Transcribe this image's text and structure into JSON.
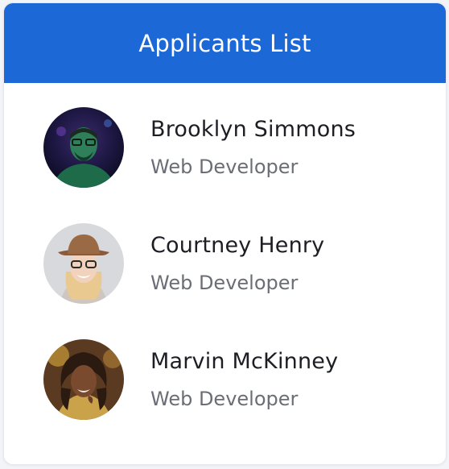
{
  "header": {
    "title": "Applicants List"
  },
  "applicants": [
    {
      "name": "Brooklyn Simmons",
      "role": "Web Developer"
    },
    {
      "name": "Courtney Henry",
      "role": "Web Developer"
    },
    {
      "name": "Marvin McKinney",
      "role": "Web Developer"
    }
  ],
  "colors": {
    "header_background": "#1b68d6",
    "header_text": "#ffffff",
    "name_text": "#1c1e24",
    "role_text": "#6b6e76"
  }
}
